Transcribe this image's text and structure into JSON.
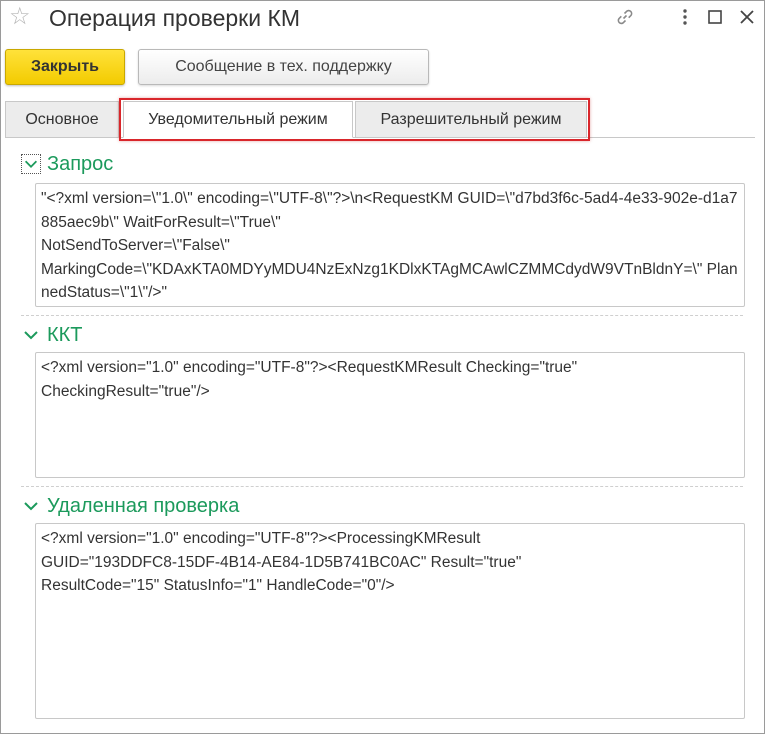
{
  "window": {
    "title": "Операция проверки КМ",
    "icons": [
      "star-icon",
      "link-icon",
      "more-icon",
      "maximize-icon",
      "close-icon"
    ]
  },
  "toolbar": {
    "close_label": "Закрыть",
    "support_label": "Сообщение в тех. поддержку"
  },
  "tabs": [
    {
      "label": "Основное"
    },
    {
      "label": "Уведомительный режим"
    },
    {
      "label": "Разрешительный режим"
    }
  ],
  "sections": {
    "request": {
      "title": "Запрос",
      "text": "\"<?xml version=\\\"1.0\\\" encoding=\\\"UTF-8\\\"?>\\n<RequestKM GUID=\\\"d7bd3f6c-5ad4-4e33-902e-d1a7885aec9b\\\" WaitForResult=\\\"True\\\"\nNotSendToServer=\\\"False\\\"\nMarkingCode=\\\"KDAxKTA0MDYyMDU4NzExNzg1KDlxKTAgMCAwlCZMMCdydW9VTnBldnY=\\\" PlannedStatus=\\\"1\\\"/>\""
    },
    "kkt": {
      "title": "ККТ",
      "text": "<?xml version=\"1.0\" encoding=\"UTF-8\"?><RequestKMResult Checking=\"true\"\nCheckingResult=\"true\"/>"
    },
    "remote": {
      "title": "Удаленная проверка",
      "text": "<?xml version=\"1.0\" encoding=\"UTF-8\"?><ProcessingKMResult\nGUID=\"193DDFC8-15DF-4B14-AE84-1D5B741BC0AC\" Result=\"true\"\nResultCode=\"15\" StatusInfo=\"1\" HandleCode=\"0\"/>"
    }
  },
  "colors": {
    "accent_yellow": "#f3cb00",
    "section_green": "#1c9a5c",
    "highlight_red": "#d9262b"
  }
}
